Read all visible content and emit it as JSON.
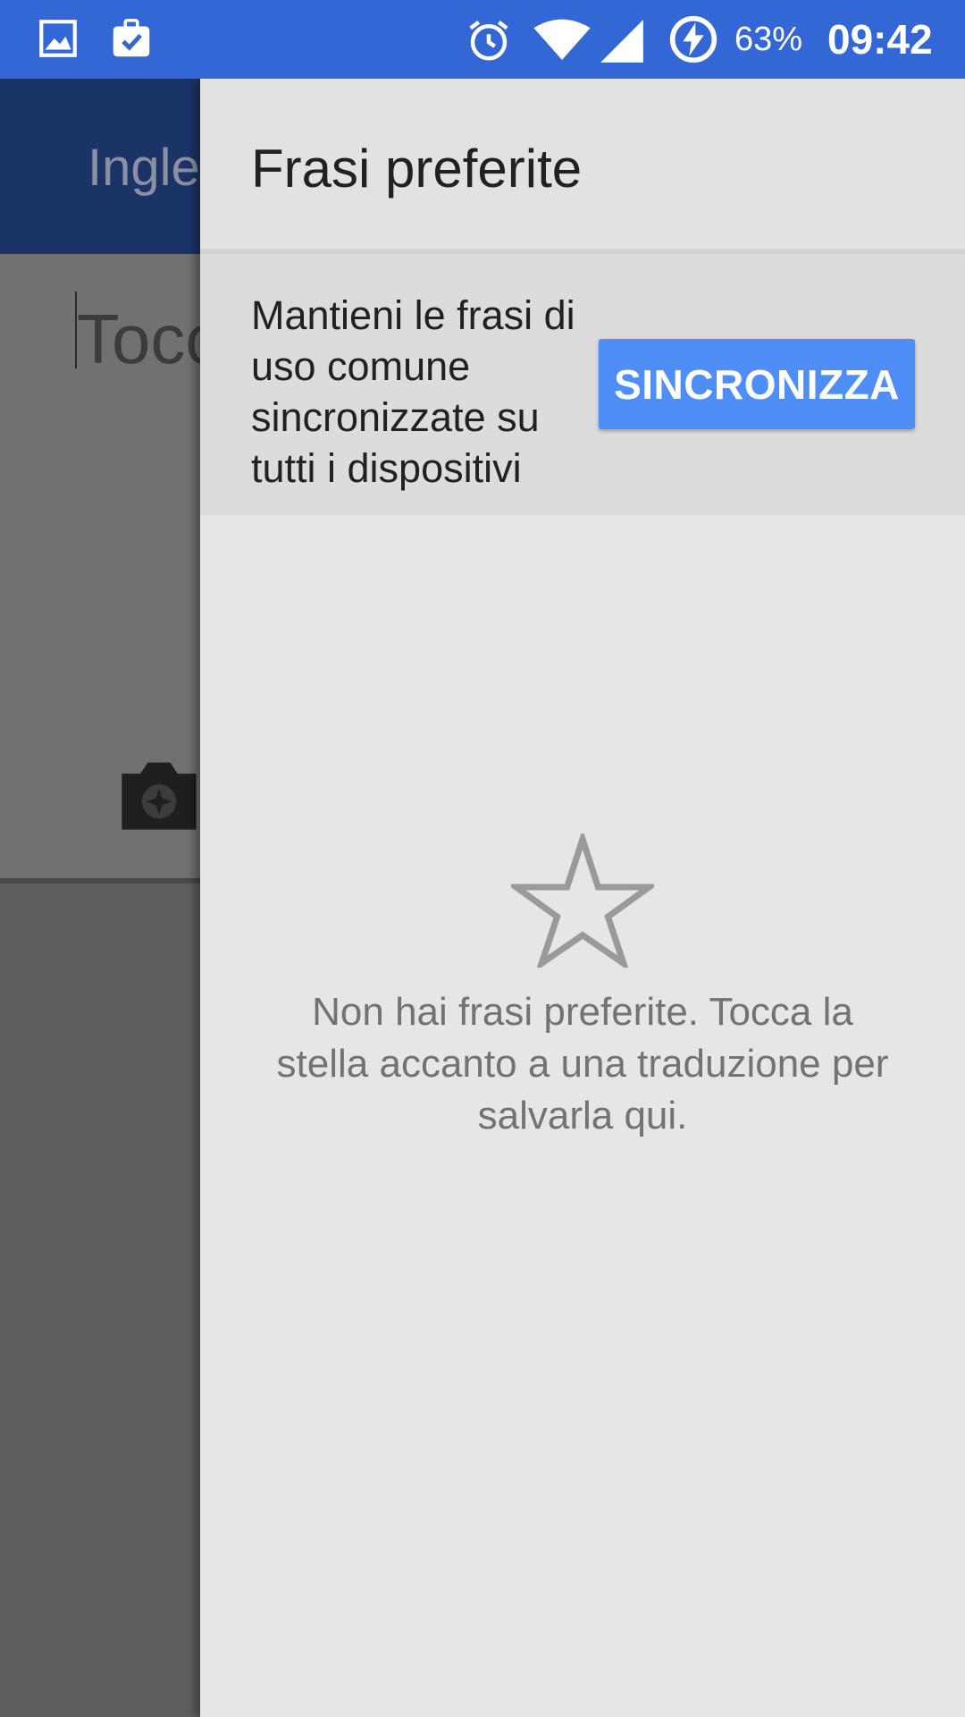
{
  "status_bar": {
    "battery_percent": "63%",
    "time": "09:42",
    "icons": [
      "image-icon",
      "clipboard-check-icon",
      "alarm-icon",
      "wifi-icon",
      "signal-icon",
      "battery-charging-icon"
    ]
  },
  "background_app": {
    "source_language": "Ingle",
    "input_placeholder": "Tocc",
    "icons": [
      "camera-icon"
    ]
  },
  "drawer": {
    "title": "Frasi preferite",
    "sync_card": {
      "message": "Mantieni le frasi di uso comune sincronizzate su tutti i dispositivi",
      "button_label": "SINCRONIZZA"
    },
    "empty_state": {
      "icon": "star-outline-icon",
      "message": "Non hai frasi preferite. Tocca la stella accanto a una traduzione per salvarla qui."
    }
  },
  "colors": {
    "status_bar": "#3367d6",
    "accent_button": "#4f8ef7",
    "drawer_background": "#e6e6e6"
  }
}
